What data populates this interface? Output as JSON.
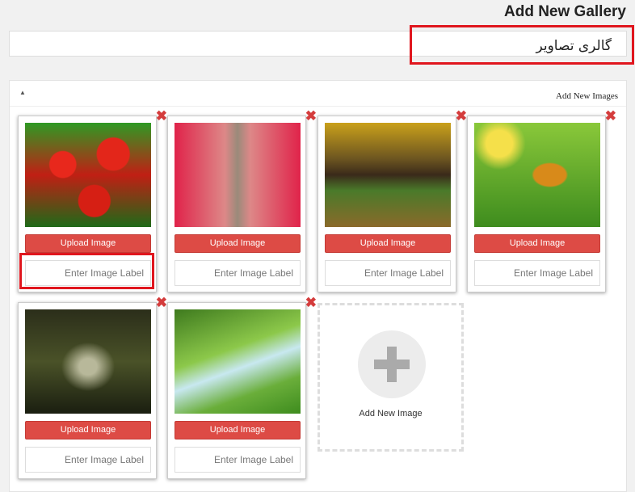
{
  "header": {
    "title": "Add New Gallery"
  },
  "gallery_name": {
    "value": "گالری تصاویر"
  },
  "panel": {
    "toggle_icon": "triangle-up",
    "title": "Add New Images"
  },
  "cards": [
    {
      "image": "red tulips",
      "upload_label": "Upload Image",
      "label_placeholder": "Enter Image Label"
    },
    {
      "image": "tulip field path",
      "upload_label": "Upload Image",
      "label_placeholder": "Enter Image Label"
    },
    {
      "image": "autumn cabin by river",
      "upload_label": "Upload Image",
      "label_placeholder": "Enter Image Label"
    },
    {
      "image": "butterfly on leaf",
      "upload_label": "Upload Image",
      "label_placeholder": "Enter Image Label"
    },
    {
      "image": "dark forest stream",
      "upload_label": "Upload Image",
      "label_placeholder": "Enter Image Label"
    },
    {
      "image": "green tree meadow",
      "upload_label": "Upload Image",
      "label_placeholder": "Enter Image Label"
    }
  ],
  "add_new": {
    "label": "Add New Image",
    "icon": "plus-icon"
  },
  "colors": {
    "button": "#dd4b45",
    "highlight": "#e0161e",
    "delete": "#d43c3c"
  }
}
